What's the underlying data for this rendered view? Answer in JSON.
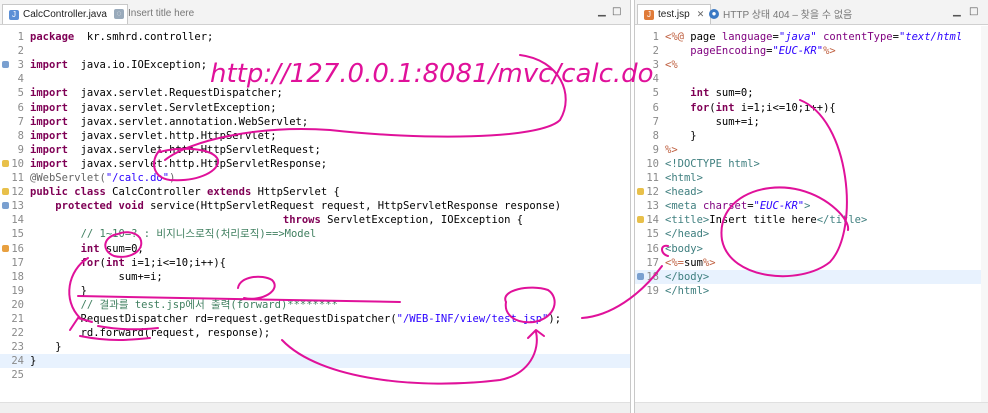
{
  "left_editor": {
    "tabs": [
      {
        "label": "CalcController.java",
        "active": true
      },
      {
        "label": "Insert title here",
        "active": false
      }
    ],
    "lines": [
      {
        "n": "1",
        "segs": [
          [
            "kw",
            "package"
          ],
          [
            "",
            "  kr.smhrd.controller;"
          ]
        ]
      },
      {
        "n": "2",
        "segs": []
      },
      {
        "n": "3",
        "segs": [
          [
            "kw",
            "import"
          ],
          [
            "",
            "  java.io.IOException;"
          ]
        ]
      },
      {
        "n": "4",
        "segs": []
      },
      {
        "n": "5",
        "segs": [
          [
            "kw",
            "import"
          ],
          [
            "",
            "  javax.servlet.RequestDispatcher;"
          ]
        ]
      },
      {
        "n": "6",
        "segs": [
          [
            "kw",
            "import"
          ],
          [
            "",
            "  javax.servlet.ServletException;"
          ]
        ]
      },
      {
        "n": "7",
        "segs": [
          [
            "kw",
            "import"
          ],
          [
            "",
            "  javax.servlet.annotation.WebServlet;"
          ]
        ]
      },
      {
        "n": "8",
        "segs": [
          [
            "kw",
            "import"
          ],
          [
            "",
            "  javax.servlet.http.HttpServlet;"
          ]
        ]
      },
      {
        "n": "9",
        "segs": [
          [
            "kw",
            "import"
          ],
          [
            "",
            "  javax.servlet.http.HttpServletRequest;"
          ]
        ]
      },
      {
        "n": "10",
        "segs": [
          [
            "kw",
            "import"
          ],
          [
            "",
            "  javax.servlet.http.HttpServletResponse;"
          ]
        ]
      },
      {
        "n": "11",
        "segs": [
          [
            "ann",
            "@WebServlet("
          ],
          [
            "str",
            "\"/calc.do\""
          ],
          [
            "ann",
            ")"
          ]
        ]
      },
      {
        "n": "12",
        "segs": [
          [
            "kw",
            "public class"
          ],
          [
            "",
            " CalcController "
          ],
          [
            "kw",
            "extends"
          ],
          [
            "",
            " HttpServlet {"
          ]
        ]
      },
      {
        "n": "13",
        "segs": [
          [
            "",
            "    "
          ],
          [
            "kw",
            "protected void"
          ],
          [
            "",
            " service(HttpServletRequest request, HttpServletResponse response)"
          ]
        ]
      },
      {
        "n": "14",
        "segs": [
          [
            "",
            "                                        "
          ],
          [
            "kw",
            "throws"
          ],
          [
            "",
            " ServletException, IOException {"
          ]
        ]
      },
      {
        "n": "15",
        "segs": [
          [
            "cm",
            "        // 1~10=? : 비지니스로직(처리로직)==>Model"
          ]
        ]
      },
      {
        "n": "16",
        "segs": [
          [
            "",
            "        "
          ],
          [
            "kw",
            "int"
          ],
          [
            "",
            " sum=0;"
          ]
        ]
      },
      {
        "n": "17",
        "segs": [
          [
            "",
            "        "
          ],
          [
            "kw",
            "for"
          ],
          [
            "",
            "("
          ],
          [
            "kw",
            "int"
          ],
          [
            "",
            " i=1;i<=10;i++){"
          ]
        ]
      },
      {
        "n": "18",
        "segs": [
          [
            "",
            "              sum+=i;"
          ]
        ]
      },
      {
        "n": "19",
        "segs": [
          [
            "",
            "        }"
          ]
        ]
      },
      {
        "n": "20",
        "segs": [
          [
            "cm",
            "        // 결과를 test.jsp에서 출력(forward)********"
          ]
        ]
      },
      {
        "n": "21",
        "segs": [
          [
            "",
            "        RequestDispatcher rd=request.getRequestDispatcher("
          ],
          [
            "str",
            "\"/WEB-INF/view/test.jsp\""
          ],
          [
            "",
            ");"
          ]
        ]
      },
      {
        "n": "22",
        "segs": [
          [
            "",
            "        rd.forward(request, response);"
          ]
        ]
      },
      {
        "n": "23",
        "segs": [
          [
            "",
            "    }"
          ]
        ]
      },
      {
        "n": "24",
        "segs": [
          [
            "",
            "}"
          ]
        ]
      },
      {
        "n": "25",
        "segs": []
      }
    ]
  },
  "right_editor": {
    "tabs": [
      {
        "label": "test.jsp",
        "active": true
      },
      {
        "label": "HTTP 상태 404 – 찾을 수 없음",
        "active": false
      }
    ],
    "lines": [
      {
        "n": "1",
        "segs": [
          [
            "jsp",
            "<%@"
          ],
          [
            "",
            " page "
          ],
          [
            "attr",
            "language"
          ],
          [
            "",
            "="
          ],
          [
            "attv",
            "\"java\""
          ],
          [
            "",
            " "
          ],
          [
            "attr",
            "contentType"
          ],
          [
            "",
            "="
          ],
          [
            "attv",
            "\"text/html"
          ]
        ]
      },
      {
        "n": "2",
        "segs": [
          [
            "",
            "    "
          ],
          [
            "attr",
            "pageEncoding"
          ],
          [
            "",
            "="
          ],
          [
            "attv",
            "\"EUC-KR\""
          ],
          [
            "jsp",
            "%>"
          ]
        ]
      },
      {
        "n": "3",
        "segs": [
          [
            "jsp",
            "<%"
          ]
        ]
      },
      {
        "n": "4",
        "segs": []
      },
      {
        "n": "5",
        "segs": [
          [
            "",
            "    "
          ],
          [
            "kw",
            "int"
          ],
          [
            "",
            " sum=0;"
          ]
        ]
      },
      {
        "n": "6",
        "segs": [
          [
            "",
            "    "
          ],
          [
            "kw",
            "for"
          ],
          [
            "",
            "("
          ],
          [
            "kw",
            "int"
          ],
          [
            "",
            " i=1;i<=10;i++){"
          ]
        ]
      },
      {
        "n": "7",
        "segs": [
          [
            "",
            "        sum+=i;"
          ]
        ]
      },
      {
        "n": "8",
        "segs": [
          [
            "",
            "    }"
          ]
        ]
      },
      {
        "n": "9",
        "segs": [
          [
            "jsp",
            "%>"
          ]
        ]
      },
      {
        "n": "10",
        "segs": [
          [
            "tag",
            "<!DOCTYPE html>"
          ]
        ]
      },
      {
        "n": "11",
        "segs": [
          [
            "tag",
            "<html>"
          ]
        ]
      },
      {
        "n": "12",
        "segs": [
          [
            "tag",
            "<head>"
          ]
        ]
      },
      {
        "n": "13",
        "segs": [
          [
            "tag",
            "<meta "
          ],
          [
            "attr",
            "charset"
          ],
          [
            "",
            "="
          ],
          [
            "attv",
            "\"EUC-KR\""
          ],
          [
            "tag",
            ">"
          ]
        ]
      },
      {
        "n": "14",
        "segs": [
          [
            "tag",
            "<title>"
          ],
          [
            "",
            "Insert title here"
          ],
          [
            "tag",
            "</title>"
          ]
        ]
      },
      {
        "n": "15",
        "segs": [
          [
            "tag",
            "</head>"
          ]
        ]
      },
      {
        "n": "16",
        "segs": [
          [
            "tag",
            "<body>"
          ]
        ]
      },
      {
        "n": "17",
        "segs": [
          [
            "jsp",
            "<%="
          ],
          [
            "",
            "sum"
          ],
          [
            "jsp",
            "%>"
          ]
        ]
      },
      {
        "n": "18",
        "segs": [
          [
            "tag",
            "</body>"
          ]
        ]
      },
      {
        "n": "19",
        "segs": [
          [
            "tag",
            "</html>"
          ]
        ]
      }
    ]
  },
  "handwriting": "http://127.0.0.1:8081/mvc/calc.do",
  "colors": {
    "keyword": "#7f0055",
    "string": "#2a00ff",
    "comment": "#3f7f5f",
    "ink": "#e0119a"
  }
}
